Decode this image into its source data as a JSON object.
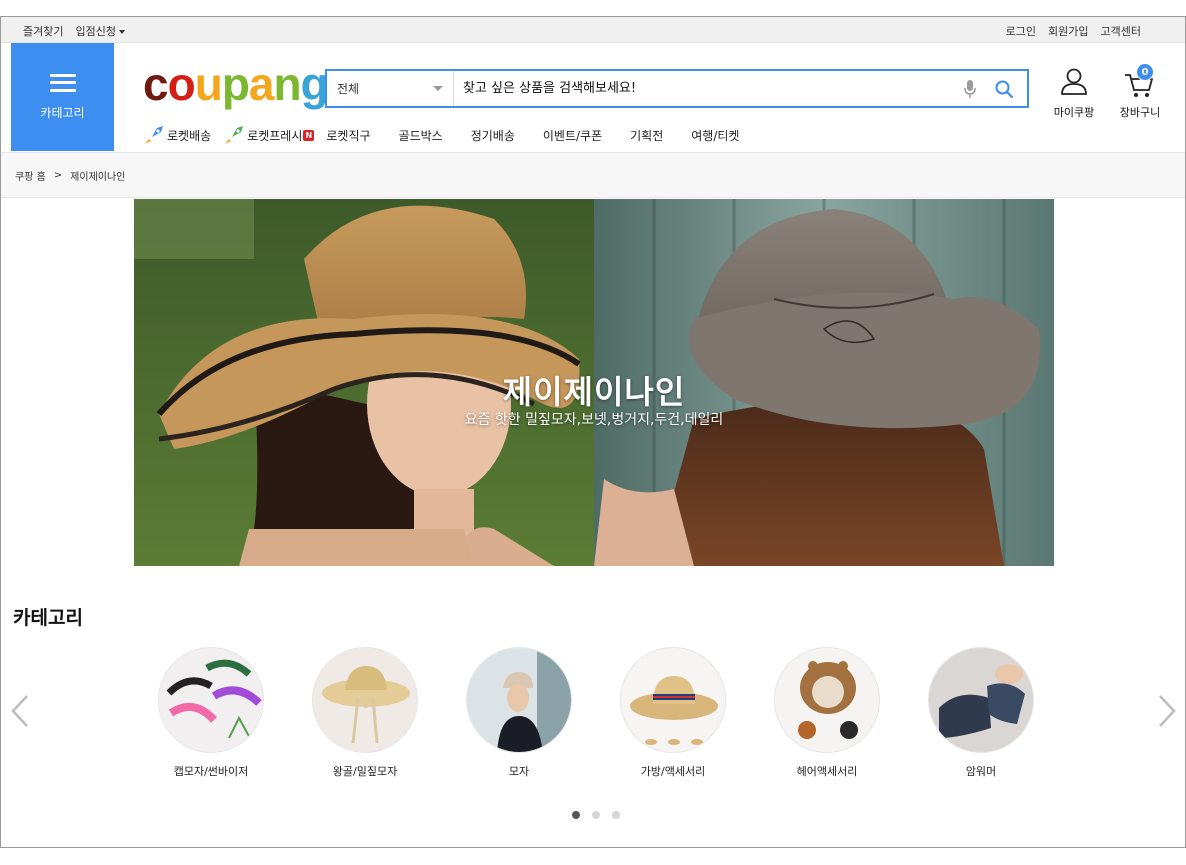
{
  "topbar": {
    "left": [
      "즐겨찾기",
      "입점신청"
    ],
    "right": [
      "로그인",
      "회원가입",
      "고객센터"
    ]
  },
  "header": {
    "category_label": "카테고리",
    "logo_text": "coupang",
    "search": {
      "scope": "전체",
      "placeholder": "찾고 싶은 상품을 검색해보세요!"
    },
    "user_label": "마이쿠팡",
    "cart_label": "장바구니",
    "cart_count": "0"
  },
  "gnb": [
    "로켓배송",
    "로켓프레시",
    "로켓직구",
    "골드박스",
    "정기배송",
    "이벤트/쿠폰",
    "기획전",
    "여행/티켓"
  ],
  "breadcrumb": [
    "쿠팡 홈",
    ">",
    "제이제이나인"
  ],
  "banner": {
    "title": "제이제이나인",
    "subtitle": "요즘 핫한 밀짚모자,보넷,벙거지,두건,데일리"
  },
  "categories": {
    "title": "카테고리",
    "items": [
      {
        "label": "캡모자/썬바이저",
        "icon": "sun-visor-image"
      },
      {
        "label": "왕골/밀짚모자",
        "icon": "straw-hat-image"
      },
      {
        "label": "모자",
        "icon": "cap-model-image"
      },
      {
        "label": "가방/액세서리",
        "icon": "boater-hat-image"
      },
      {
        "label": "헤어액세서리",
        "icon": "bonnet-image"
      },
      {
        "label": "암워머",
        "icon": "arm-warmer-image"
      }
    ],
    "pager": {
      "total": 3,
      "active": 1
    }
  },
  "colors": {
    "accent": "#3d8ef0",
    "badge_red": "#e02020"
  }
}
